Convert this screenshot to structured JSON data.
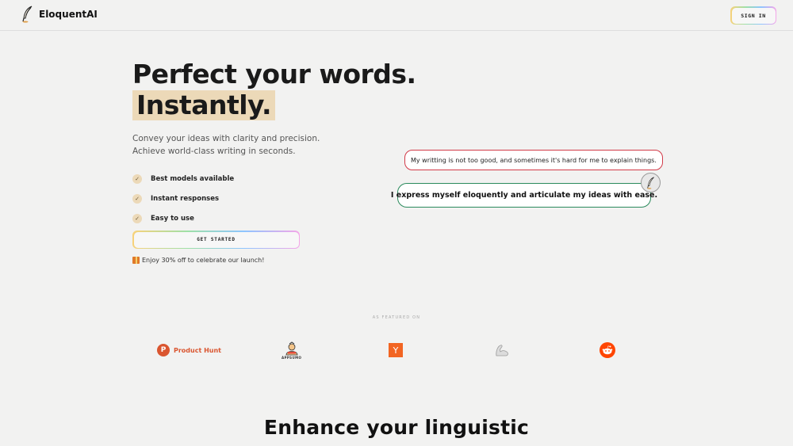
{
  "nav": {
    "brand": "EloquentAI",
    "brand_icon": "quill-icon",
    "signin_label": "SIGN IN"
  },
  "hero": {
    "title_line1": "Perfect your words.",
    "title_line2": "Instantly.",
    "lead": "Convey your ideas with clarity and precision. Achieve world-class writing in seconds.",
    "features": [
      {
        "label": "Best models available",
        "icon": "check-icon"
      },
      {
        "label": "Instant responses",
        "icon": "check-icon"
      },
      {
        "label": "Easy to use",
        "icon": "check-icon"
      }
    ],
    "cta_label": "GET STARTED",
    "promo_icon": "gift-icon",
    "promo": "Enjoy 30% off to celebrate our launch!"
  },
  "demo": {
    "before": "My writting is not too good, and sometimes it's hard for me to explain things.",
    "after": "I express myself eloquently and articulate my ideas with ease.",
    "avatar_icon": "quill-icon",
    "before_color": "#d23a48",
    "after_color": "#2a8a5c"
  },
  "featured": {
    "label": "AS FEATURED ON",
    "logos": [
      {
        "name": "Product Hunt",
        "icon": "product-hunt-icon",
        "mark": "P",
        "color": "#da552f"
      },
      {
        "name": "APPSUMO",
        "icon": "appsumo-icon"
      },
      {
        "name": "Y Combinator",
        "icon": "ycombinator-icon",
        "mark": "Y",
        "color": "#f26522"
      },
      {
        "name": "Arm",
        "icon": "flexed-arm-icon"
      },
      {
        "name": "Reddit",
        "icon": "reddit-icon",
        "color": "#ff4500"
      }
    ]
  },
  "section2": {
    "heading": "Enhance your linguistic"
  },
  "colors": {
    "background": "#f2f2f1",
    "highlight": "#ecd9b8"
  }
}
